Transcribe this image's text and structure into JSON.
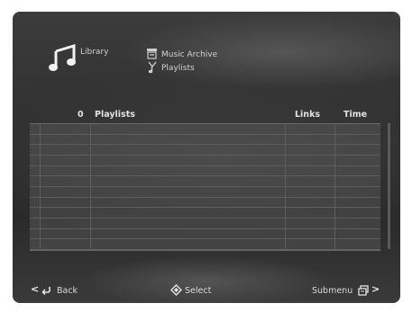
{
  "header": {
    "library_label": "Library",
    "archive_label": "Music Archive",
    "playlists_label": "Playlists"
  },
  "table": {
    "count": "0",
    "title": "Playlists",
    "links_header": "Links",
    "time_header": "Time",
    "rows": 12
  },
  "footer": {
    "back_label": "Back",
    "select_label": "Select",
    "submenu_label": "Submenu"
  },
  "icons": {
    "library": "music-note-icon",
    "archive": "archive-icon",
    "playlists": "playlist-icon",
    "back": "back-arrow-icon",
    "select": "select-diamond-icon",
    "submenu": "submenu-icon"
  }
}
